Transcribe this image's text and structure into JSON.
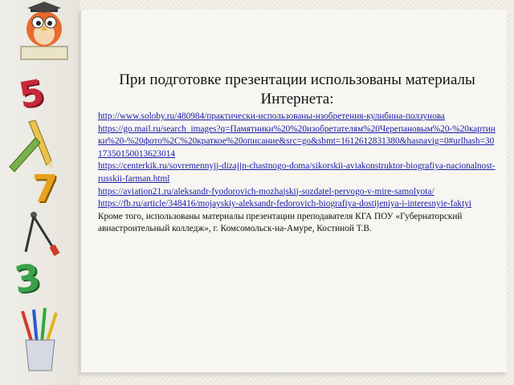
{
  "slide": {
    "title": "При подготовке презентации использованы материалы Интернета:",
    "links": [
      "http://www.soloby.ru/480984/практически-использованы-изобретения-кулибина-ползунова",
      "https://go.mail.ru/search_images?q=Памятники%20%20изобретателям%20Черепановым%20-%20картинки%20-%20фото%2C%20краткое%20описание&src=go&sbmt=1612612831380&hasnavig=0#urlhash=3017350150013623014",
      "https://centerkik.ru/sovremennyjj-dizajjn-chastnogo-doma/sikorskii-aviakonstruktor-biografiya-nacionalnost-russkii-farman.html",
      "https://aviation21.ru/aleksandr-fyodorovich-mozhajskij-sozdatel-pervogo-v-mire-samolyota/",
      "https://fb.ru/article/348416/mojayskiy-aleksandr-fedorovich-biografiya-dostijeniya-i-interesnyie-faktyi"
    ],
    "note": "Кроме того, использованы материалы презентации преподавателя КГА ПОУ «Губернаторский авиастроительный колледж», г. Комсомольск-на-Амуре, Костиной Т.В."
  },
  "decor": {
    "digits": [
      "5",
      "7",
      "3"
    ],
    "icons": [
      "owl-teacher-icon",
      "pencil-icon",
      "ruler-icon",
      "compass-icon",
      "pencil-cup-icon"
    ]
  }
}
